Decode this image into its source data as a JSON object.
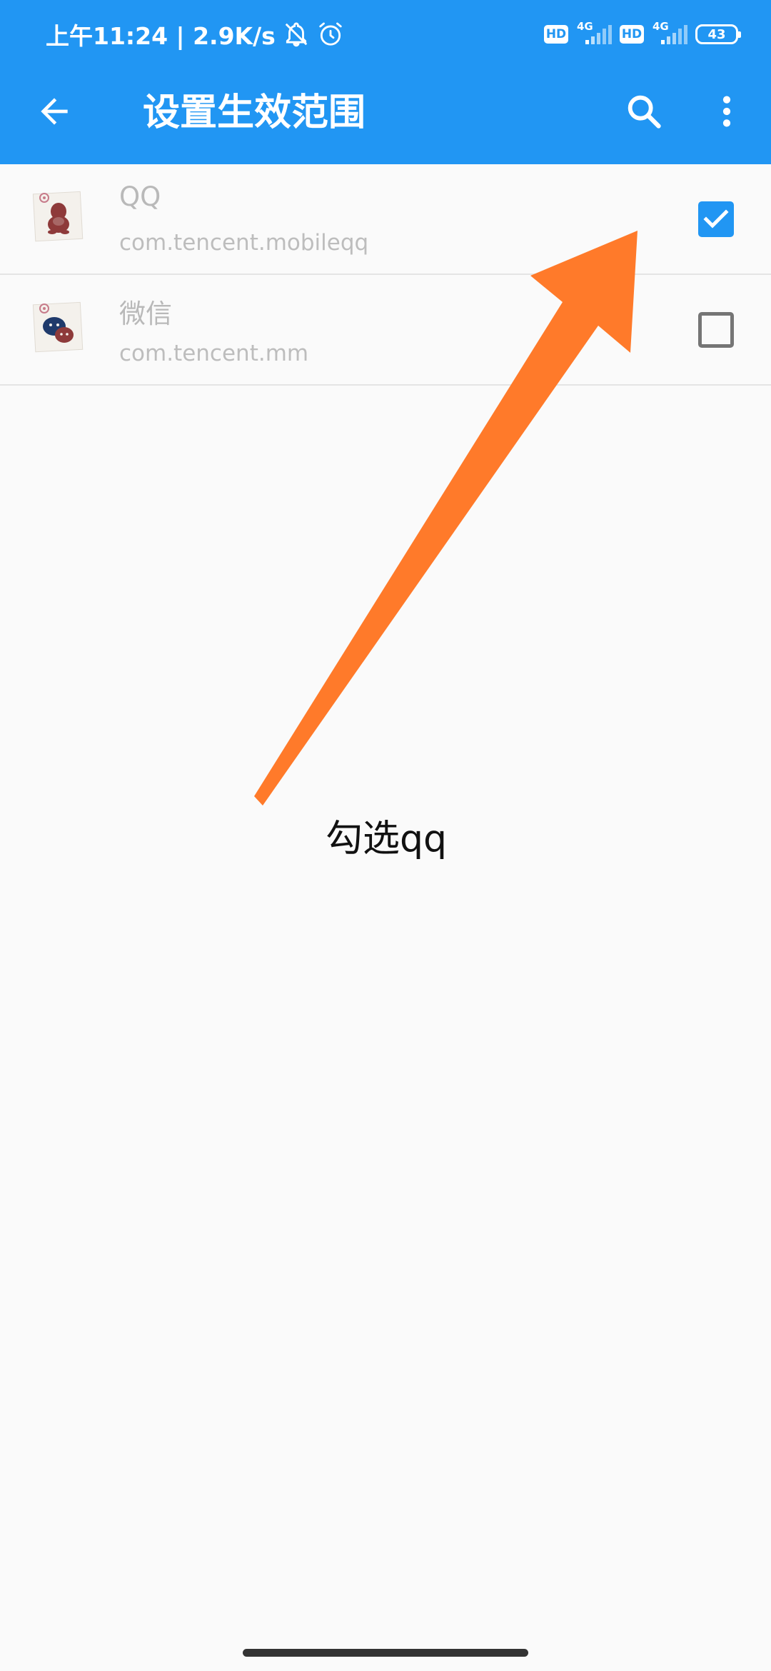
{
  "status_bar": {
    "time_speed": "上午11:24 | 2.9K/s",
    "icons": [
      "bell-off-icon",
      "alarm-icon",
      "hd-icon",
      "signal-4g-icon",
      "hd-icon",
      "signal-4g-icon",
      "battery-icon"
    ],
    "hd_label": "HD",
    "network_label": "4G",
    "battery_level": "43"
  },
  "app_bar": {
    "title": "设置生效范围",
    "back_icon": "arrow-back-icon",
    "search_icon": "search-icon",
    "more_icon": "more-vert-icon"
  },
  "apps": [
    {
      "name": "QQ",
      "package": "com.tencent.mobileqq",
      "checked": true,
      "icon": "qq-app-icon"
    },
    {
      "name": "微信",
      "package": "com.tencent.mm",
      "checked": false,
      "icon": "wechat-app-icon"
    }
  ],
  "annotation": {
    "text": "勾选qq",
    "arrow_color": "#ff7a2a"
  },
  "colors": {
    "primary": "#2196f3",
    "background": "#fafafa",
    "divider": "#e4e4e4",
    "secondary_text": "#bdbdbd"
  }
}
